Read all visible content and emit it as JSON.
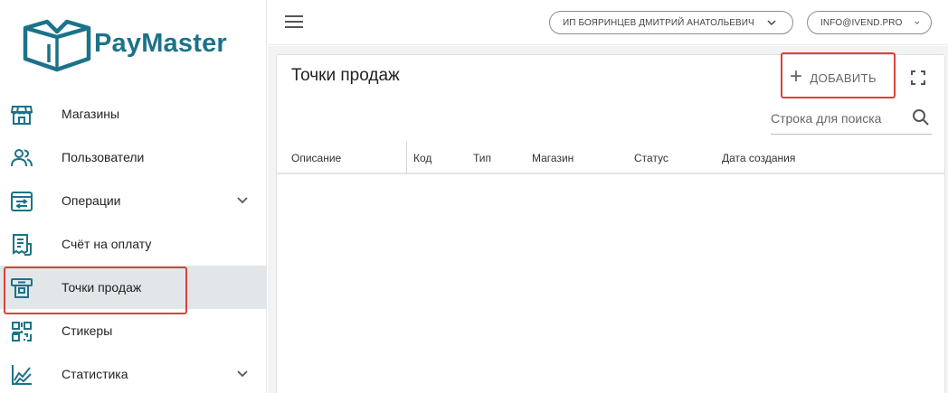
{
  "brand": {
    "name": "PayMaster",
    "color": "#1b7389"
  },
  "accent_highlight": "#d9423b",
  "sidebar": {
    "items": [
      {
        "label": "Магазины",
        "icon": "store-icon",
        "has_chevron": false,
        "active": false
      },
      {
        "label": "Пользователи",
        "icon": "users-icon",
        "has_chevron": false,
        "active": false
      },
      {
        "label": "Операции",
        "icon": "operations-icon",
        "has_chevron": true,
        "active": false
      },
      {
        "label": "Счёт на оплату",
        "icon": "invoice-icon",
        "has_chevron": false,
        "active": false
      },
      {
        "label": "Точки продаж",
        "icon": "point-of-sale-icon",
        "has_chevron": false,
        "active": true
      },
      {
        "label": "Стикеры",
        "icon": "qr-sticker-icon",
        "has_chevron": false,
        "active": false
      },
      {
        "label": "Статистика",
        "icon": "statistics-icon",
        "has_chevron": true,
        "active": false
      }
    ]
  },
  "topbar": {
    "company": "ИП БОЯРИНЦЕВ ДМИТРИЙ АНАТОЛЬЕВИЧ",
    "email": "INFO@IVEND.PRO"
  },
  "page": {
    "title": "Точки продаж",
    "add_label": "ДОБАВИТЬ",
    "search_placeholder": "Строка для поиска",
    "columns": [
      "Описание",
      "Код",
      "Тип",
      "Магазин",
      "Статус",
      "Дата создания"
    ]
  }
}
